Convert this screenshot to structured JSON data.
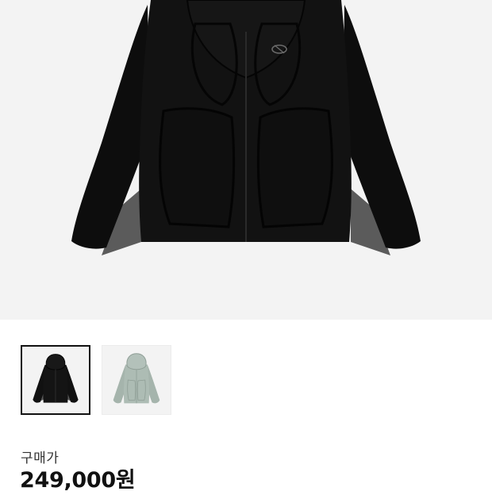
{
  "product": {
    "variants": [
      {
        "name": "black-jacket",
        "color": "#111111",
        "accent": "#5e5e5e",
        "selected": true
      },
      {
        "name": "mint-jacket",
        "color": "#a8b7af",
        "accent": "#c6d1ca",
        "selected": false
      }
    ],
    "price_label": "구매가",
    "price_value": "249,000원"
  },
  "colors": {
    "hero_bg": "#f3f3f3",
    "selected_border": "#111111"
  }
}
